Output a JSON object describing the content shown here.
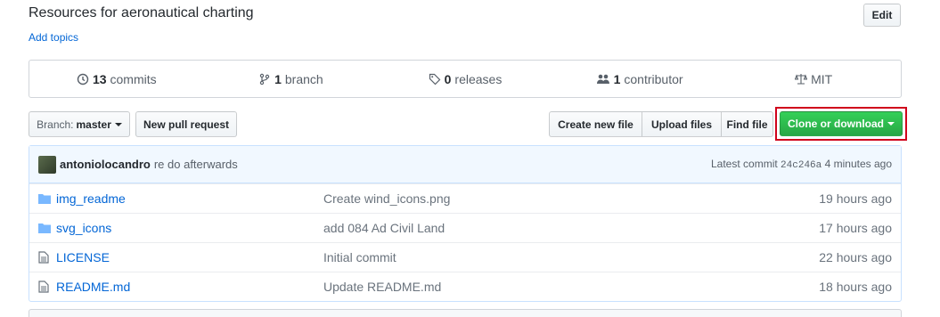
{
  "repo": {
    "description": "Resources for aeronautical charting",
    "add_topics": "Add topics",
    "edit_label": "Edit"
  },
  "numbers": [
    {
      "icon": "history-icon",
      "count": "13",
      "label": "commits"
    },
    {
      "icon": "branch-icon",
      "count": "1",
      "label": "branch"
    },
    {
      "icon": "tag-icon",
      "count": "0",
      "label": "releases"
    },
    {
      "icon": "people-icon",
      "count": "1",
      "label": "contributor"
    },
    {
      "icon": "law-icon",
      "count": "",
      "label": "MIT"
    }
  ],
  "toolbar": {
    "branch_label": "Branch:",
    "branch_value": "master",
    "new_pr": "New pull request",
    "create_file": "Create new file",
    "upload_files": "Upload files",
    "find_file": "Find file",
    "clone": "Clone or download",
    "clone_color": "#28a745",
    "highlight_color": "#d0021b"
  },
  "commit": {
    "author": "antoniolocandro",
    "message": "re do afterwards",
    "latest_prefix": "Latest commit",
    "sha": "24c246a",
    "age": "4 minutes ago"
  },
  "files": [
    {
      "type": "folder",
      "name": "img_readme",
      "message": "Create wind_icons.png",
      "age": "19 hours ago"
    },
    {
      "type": "folder",
      "name": "svg_icons",
      "message": "add 084 Ad Civil Land",
      "age": "17 hours ago"
    },
    {
      "type": "file",
      "name": "LICENSE",
      "message": "Initial commit",
      "age": "22 hours ago"
    },
    {
      "type": "file",
      "name": "README.md",
      "message": "Update README.md",
      "age": "18 hours ago"
    }
  ]
}
